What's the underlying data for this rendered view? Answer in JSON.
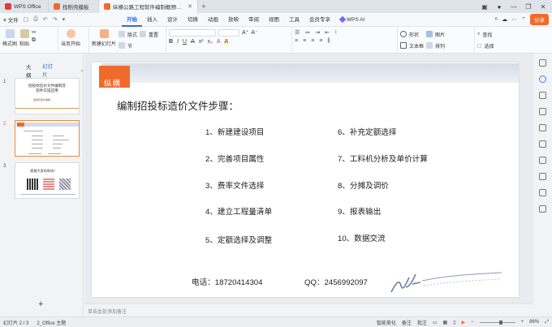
{
  "titlebar": {
    "tabs": [
      {
        "label": "WPS Office",
        "color": "#e23c33"
      },
      {
        "label": "找稻壳模板",
        "color": "#ef6b2b"
      },
      {
        "label": "纵横公路工程软件编制概预算：",
        "color": "#ef6b2b"
      }
    ],
    "add_tab": "+"
  },
  "menubar": {
    "file": "≡ 文件",
    "items": [
      "开始",
      "插入",
      "设计",
      "切换",
      "动画",
      "放映",
      "审阅",
      "视图",
      "工具",
      "会员专享"
    ],
    "active": "开始",
    "wps_ai": "WPS AI",
    "share": "分享"
  },
  "ribbon": {
    "format_painter": "格式刷",
    "paste": "粘贴",
    "start_from_current": "当页开始",
    "new_slide": "新建幻灯片",
    "layout": "版式",
    "section": "节",
    "reset": "重置",
    "shape": "形状",
    "picture": "图片",
    "textbox": "文本框",
    "arrange": "排列",
    "find": "查找",
    "select": "选择",
    "format_buttons": [
      "B",
      "I",
      "U",
      "A",
      "x²",
      "x₂",
      "A",
      "A"
    ]
  },
  "left_panel": {
    "tab_outline": "大纲",
    "tab_slides": "幻灯片",
    "slide1": {
      "num": "1",
      "title": "招投标造价文件编制及软件实操应用",
      "sub": "招投标造价编制"
    },
    "slide2": {
      "num": "2"
    },
    "slide3": {
      "num": "3",
      "title": "感谢大家的聆听！"
    },
    "add": "+"
  },
  "slide": {
    "logo_text": "纵横",
    "title": "编制招投标造价文件步骤：",
    "steps_left": [
      "1、新建建设项目",
      "2、完善项目属性",
      "3、费率文件选择",
      "4、建立工程量清单",
      "5、定额选择及调整"
    ],
    "steps_right": [
      "6、补充定额选择",
      "7、工料机分析及单价计算",
      "8、分摊及调价",
      "9、报表输出",
      "10、数据交流"
    ],
    "phone": "电话：18720414304",
    "qq": "QQ：2456992097"
  },
  "notes_placeholder": "单击此处添加备注",
  "statusbar": {
    "slide_count": "幻灯片 2 / 3",
    "theme": "2_Office 主题",
    "beautify": "智能美化",
    "notes": "备注",
    "comments": "批注",
    "zoom": "86%"
  }
}
